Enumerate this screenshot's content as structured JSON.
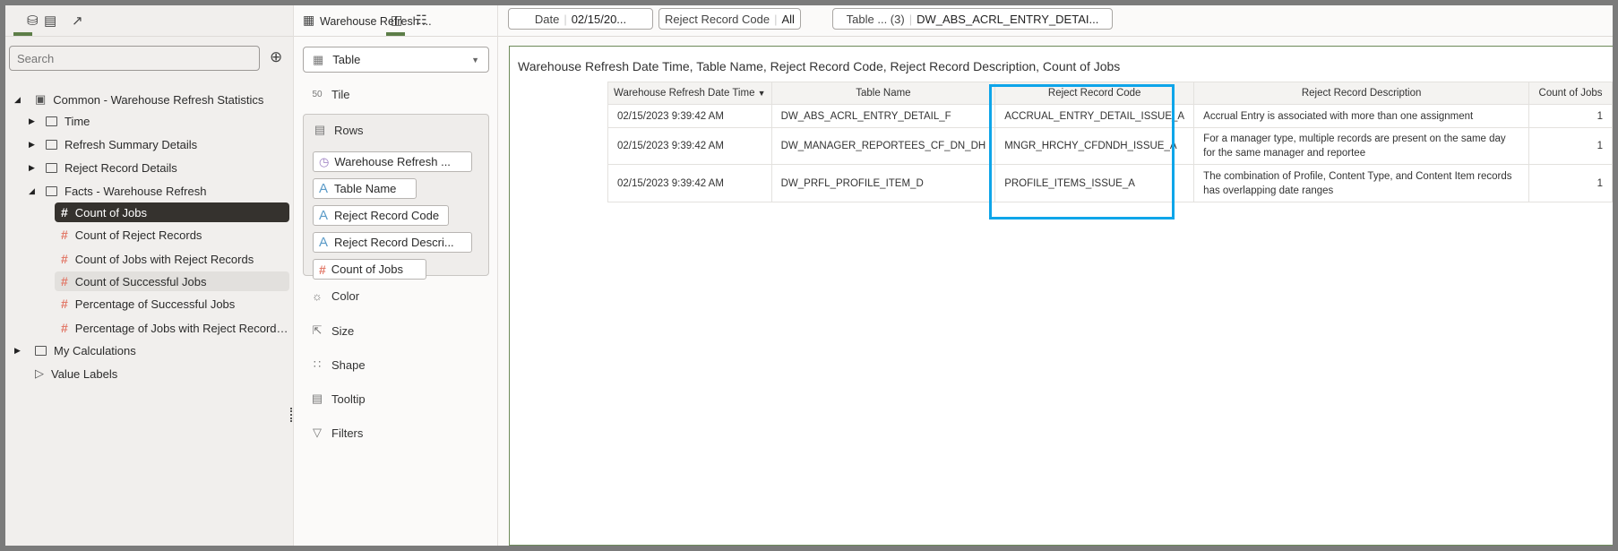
{
  "left_panel": {
    "tabs": [
      {
        "icon": "database-icon"
      },
      {
        "icon": "bar-chart-icon"
      },
      {
        "icon": "trend-icon"
      }
    ],
    "search_placeholder": "Search",
    "tree": [
      {
        "label": "Common - Warehouse Refresh Statistics",
        "level": 0,
        "type": "subject-area",
        "expanded": true
      },
      {
        "label": "Time",
        "level": 1,
        "type": "folder"
      },
      {
        "label": "Refresh Summary Details",
        "level": 1,
        "type": "folder"
      },
      {
        "label": "Reject Record Details",
        "level": 1,
        "type": "folder"
      },
      {
        "label": "Facts - Warehouse Refresh",
        "level": 1,
        "type": "folder",
        "expanded": true
      },
      {
        "label": "Count of Jobs",
        "level": 2,
        "type": "measure",
        "selected": true
      },
      {
        "label": "Count of Reject Records",
        "level": 2,
        "type": "measure"
      },
      {
        "label": "Count of Jobs with Reject Records",
        "level": 2,
        "type": "measure"
      },
      {
        "label": "Count of Successful Jobs",
        "level": 2,
        "type": "measure",
        "hover": true
      },
      {
        "label": "Percentage of Successful Jobs",
        "level": 2,
        "type": "measure"
      },
      {
        "label": "Percentage of Jobs with Reject Record…",
        "level": 2,
        "type": "measure"
      },
      {
        "label": "My Calculations",
        "level": 0,
        "type": "folder"
      },
      {
        "label": "Value Labels",
        "level": 0,
        "type": "tag"
      }
    ]
  },
  "mid_panel": {
    "title": "Warehouse Refresh ...",
    "viz_type": "Table",
    "tile_label": "Tile",
    "rows_label": "Rows",
    "rows": [
      {
        "label": "Warehouse Refresh ...",
        "icon": "clock-icon"
      },
      {
        "label": "Table Name",
        "icon": "attribute-icon"
      },
      {
        "label": "Reject Record Code",
        "icon": "attribute-icon"
      },
      {
        "label": "Reject Record Descri...",
        "icon": "attribute-icon"
      },
      {
        "label": "Count of Jobs",
        "icon": "measure-icon"
      }
    ],
    "properties": [
      "Color",
      "Size",
      "Shape",
      "Tooltip",
      "Filters"
    ]
  },
  "filters": [
    {
      "name": "Date",
      "value": "02/15/20..."
    },
    {
      "name": "Reject Record Code",
      "value": "All"
    },
    {
      "name": "Table ... (3)",
      "value": "DW_ABS_ACRL_ENTRY_DETAI..."
    }
  ],
  "viz": {
    "title": "Warehouse Refresh Date Time, Table Name, Reject Record Code, Reject Record Description, Count of Jobs",
    "columns": [
      "Warehouse Refresh Date Time",
      "Table Name",
      "Reject Record Code",
      "Reject Record Description",
      "Count of Jobs"
    ],
    "rows": [
      [
        "02/15/2023 9:39:42 AM",
        "DW_ABS_ACRL_ENTRY_DETAIL_F",
        "ACCRUAL_ENTRY_DETAIL_ISSUE_A",
        "Accrual Entry is associated with more than one assignment",
        "1"
      ],
      [
        "02/15/2023 9:39:42 AM",
        "DW_MANAGER_REPORTEES_CF_DN_DH",
        "MNGR_HRCHY_CFDNDH_ISSUE_A",
        "For a manager type, multiple records are present on the same day for the same manager and reportee",
        "1"
      ],
      [
        "02/15/2023 9:39:42 AM",
        "DW_PRFL_PROFILE_ITEM_D",
        "PROFILE_ITEMS_ISSUE_A",
        "The combination of Profile, Content Type, and Content Item records has overlapping date ranges",
        "1"
      ]
    ],
    "highlight_color": "#0ea5e9"
  }
}
